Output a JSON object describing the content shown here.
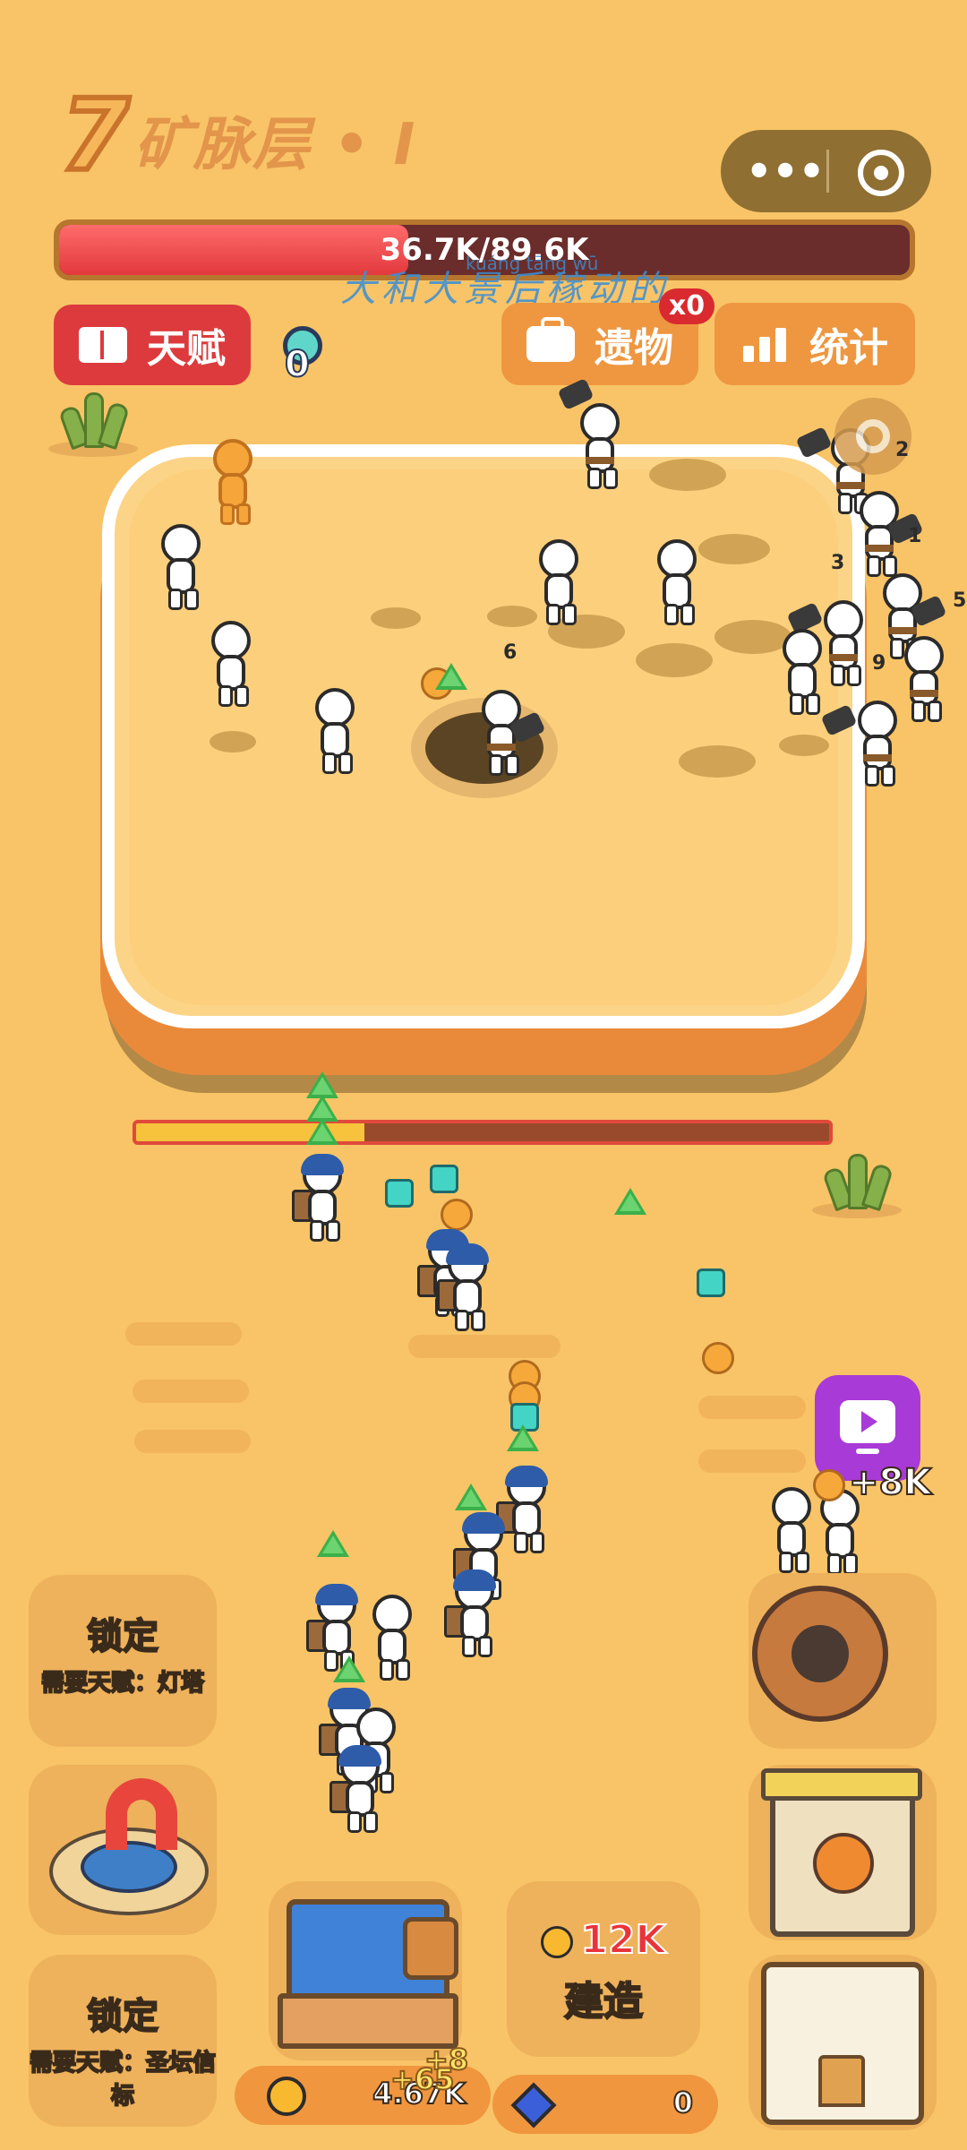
{
  "header": {
    "level_number": "7",
    "level_name": "矿脉层 • I",
    "hp_text": "36.7K/89.6K",
    "hp_fraction": 0.41,
    "overlay_text": "大和大景后稼动的",
    "overlay_pinyin": "kuáng tāng wū"
  },
  "miniprogram_capsule": {
    "menu_icon": "more-dots-icon",
    "close_icon": "target-icon"
  },
  "buttons": {
    "talent_label": "天赋",
    "relic_label": "遗物",
    "stats_label": "统计",
    "relic_badge": "x0"
  },
  "keys": {
    "count": "0"
  },
  "arena": {
    "damage_numbers": [
      "6",
      "2",
      "1",
      "3",
      "5",
      "9"
    ],
    "progress_fraction": 0.33
  },
  "rewards": {
    "video_reward": "+8K"
  },
  "panel": {
    "locked_top_title": "锁定",
    "locked_top_sub": "需要天赋：灯塔",
    "locked_bottom_title": "锁定",
    "locked_bottom_sub": "需要天赋：圣坛信标",
    "build_price": "12K",
    "build_label": "建造"
  },
  "currency": {
    "coins": "4.67K",
    "coin_gain_1": "+65",
    "coin_gain_2": "+8",
    "gems": "0"
  },
  "colors": {
    "background": "#f8c467",
    "talent_button": "#dc3a3c",
    "orange_button": "#ee9740",
    "hp_fill": "#e2393d",
    "video_button": "#a83ad7"
  }
}
